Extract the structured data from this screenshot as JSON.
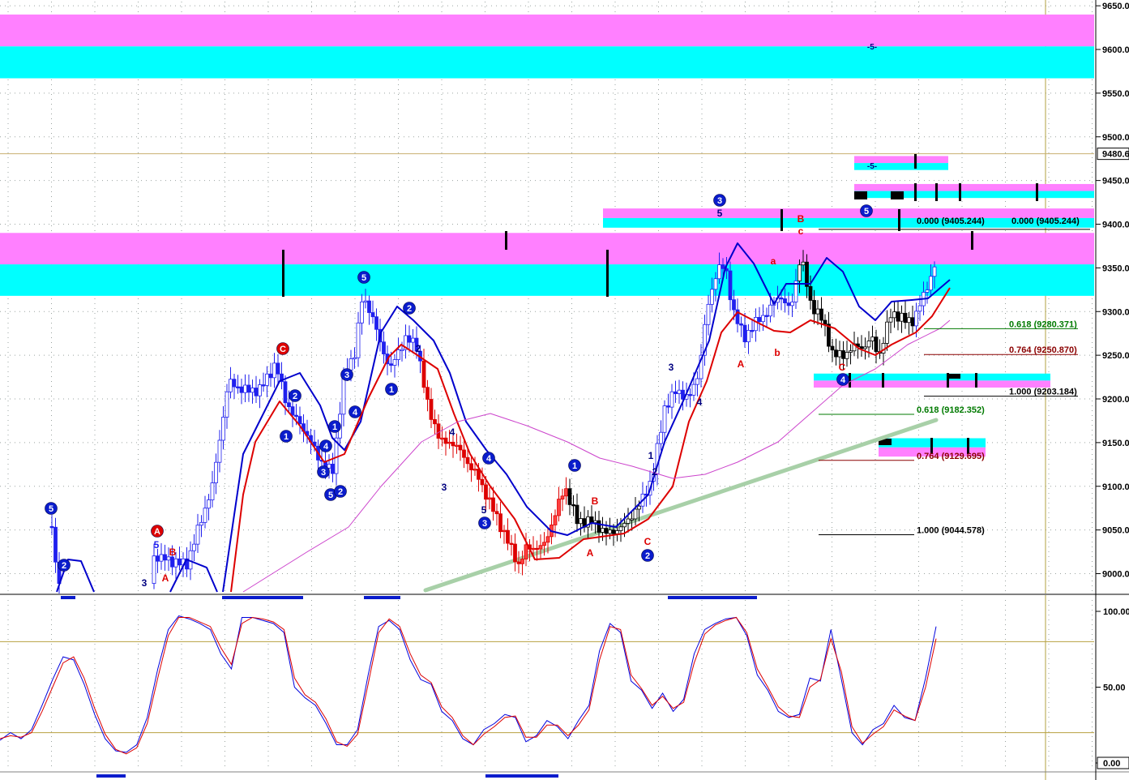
{
  "chart_data": [
    {
      "type": "candlestick",
      "title": "",
      "xlabel": "",
      "ylabel": "",
      "ylim": [
        8980,
        9650
      ],
      "y_ticks": [
        "9650.0",
        "9600.0",
        "9550.0",
        "9500.0",
        "9450.0",
        "9400.0",
        "9350.0",
        "9300.0",
        "9250.0",
        "9200.0",
        "9150.0",
        "9100.0",
        "9050.0",
        "9000.0"
      ],
      "current_price_label": "9480.6",
      "grid": true,
      "bands": [
        {
          "from": 9567,
          "to": 9640,
          "upper_color": "#ff80ff",
          "lower_color": "#00ffff",
          "span": "full"
        },
        {
          "from": 9318,
          "to": 9390,
          "upper_color": "#ff80ff",
          "lower_color": "#00ffff",
          "span": "full"
        },
        {
          "from": 9396,
          "to": 9418,
          "upper_color": "#ff80ff",
          "lower_color": "#00ffff",
          "span": "right"
        },
        {
          "from": 9462,
          "to": 9478,
          "upper_color": "#ff80ff",
          "lower_color": "#00ffff",
          "span": "box"
        },
        {
          "from": 9430,
          "to": 9446,
          "upper_color": "#ff80ff",
          "lower_color": "#00ffff",
          "span": "wide-box"
        },
        {
          "from": 9213,
          "to": 9229,
          "upper_color": "#00ffff",
          "lower_color": "#ff80ff",
          "span": "wide-box"
        },
        {
          "from": 9134,
          "to": 9155,
          "upper_color": "#00ffff",
          "lower_color": "#ff80ff",
          "span": "box"
        }
      ],
      "fib_levels": [
        {
          "label": "0.000 (9405.244)",
          "value": 9405.244,
          "color": "#000000"
        },
        {
          "label": "0.000 (9405.244)",
          "value": 9405.244,
          "color": "#000000"
        },
        {
          "label": "0.618 (9280.371)",
          "value": 9280.371,
          "color": "#007a00"
        },
        {
          "label": "0.764 (9250.870)",
          "value": 9250.87,
          "color": "#8b0000"
        },
        {
          "label": "1.000 (9203.184)",
          "value": 9203.184,
          "color": "#000000"
        },
        {
          "label": "0.618 (9182.352)",
          "value": 9182.352,
          "color": "#007a00"
        },
        {
          "label": "0.764 (9129.695)",
          "value": 9129.695,
          "color": "#8b0000"
        },
        {
          "label": "1.000 (9044.578)",
          "value": 9044.578,
          "color": "#000000"
        }
      ],
      "wave_labels": [
        {
          "text": "5",
          "style": "circle-blue"
        },
        {
          "text": "2",
          "style": "circle-blue"
        },
        {
          "text": "A",
          "style": "circle-red"
        },
        {
          "text": "5",
          "style": "plain-blue"
        },
        {
          "text": "B",
          "style": "plain-red"
        },
        {
          "text": "A",
          "style": "plain-red"
        },
        {
          "text": "3",
          "style": "plain-navy"
        },
        {
          "text": "C",
          "style": "circle-red"
        },
        {
          "text": "2",
          "style": "circle-blue"
        },
        {
          "text": "1",
          "style": "circle-blue"
        },
        {
          "text": "4",
          "style": "circle-blue"
        },
        {
          "text": "1",
          "style": "circle-blue"
        },
        {
          "text": "3",
          "style": "circle-blue"
        },
        {
          "text": "5",
          "style": "circle-blue"
        },
        {
          "text": "2",
          "style": "circle-blue"
        },
        {
          "text": "5",
          "style": "circle-blue"
        },
        {
          "text": "3",
          "style": "circle-blue"
        },
        {
          "text": "4",
          "style": "circle-blue"
        },
        {
          "text": "1",
          "style": "circle-blue"
        },
        {
          "text": "2",
          "style": "circle-blue"
        },
        {
          "text": "2",
          "style": "plain-navy"
        },
        {
          "text": "4",
          "style": "plain-navy"
        },
        {
          "text": "3",
          "style": "plain-navy"
        },
        {
          "text": "4",
          "style": "circle-blue"
        },
        {
          "text": "5",
          "style": "plain-navy"
        },
        {
          "text": "3",
          "style": "circle-blue"
        },
        {
          "text": "1",
          "style": "circle-blue"
        },
        {
          "text": "B",
          "style": "plain-red"
        },
        {
          "text": "A",
          "style": "plain-red"
        },
        {
          "text": "C",
          "style": "plain-red"
        },
        {
          "text": "2",
          "style": "circle-blue"
        },
        {
          "text": "1",
          "style": "plain-navy"
        },
        {
          "text": "2",
          "style": "plain-navy"
        },
        {
          "text": "3",
          "style": "plain-navy"
        },
        {
          "text": "4",
          "style": "plain-navy"
        },
        {
          "text": "3",
          "style": "circle-blue"
        },
        {
          "text": "5",
          "style": "plain-navy"
        },
        {
          "text": "A",
          "style": "plain-red"
        },
        {
          "text": "a",
          "style": "plain-red"
        },
        {
          "text": "b",
          "style": "plain-red"
        },
        {
          "text": "B",
          "style": "plain-red"
        },
        {
          "text": "c",
          "style": "plain-red"
        },
        {
          "text": "5",
          "style": "circle-blue"
        },
        {
          "text": "C",
          "style": "plain-red"
        },
        {
          "text": "4",
          "style": "circle-blue"
        },
        {
          "text": "-5-",
          "style": "plain-navy"
        },
        {
          "text": "-5-",
          "style": "plain-navy"
        }
      ]
    },
    {
      "type": "line",
      "title": "",
      "xlabel": "",
      "ylabel": "",
      "ylim": [
        0,
        100
      ],
      "y_ticks": [
        "100.00",
        "50.00",
        "0.00"
      ],
      "overbought": 80,
      "oversold": 20,
      "series": [
        {
          "color": "#0000dd",
          "values": [
            15,
            20,
            16,
            22,
            38,
            55,
            70,
            68,
            52,
            32,
            16,
            8,
            7,
            12,
            30,
            62,
            88,
            97,
            95,
            92,
            88,
            72,
            62,
            96,
            96,
            94,
            92,
            86,
            50,
            43,
            38,
            26,
            12,
            12,
            22,
            58,
            90,
            94,
            88,
            68,
            55,
            52,
            34,
            28,
            16,
            12,
            22,
            26,
            32,
            30,
            14,
            18,
            28,
            24,
            16,
            28,
            38,
            74,
            92,
            86,
            54,
            48,
            36,
            46,
            34,
            42,
            72,
            88,
            92,
            95,
            96,
            84,
            58,
            48,
            34,
            30,
            32,
            56,
            54,
            88,
            55,
            20,
            12,
            22,
            26,
            38,
            30,
            28,
            56,
            90
          ]
        },
        {
          "color": "#dd0000",
          "values": [
            16,
            18,
            17,
            20,
            34,
            50,
            66,
            70,
            56,
            36,
            19,
            9,
            6,
            10,
            26,
            56,
            84,
            96,
            96,
            93,
            90,
            76,
            65,
            92,
            96,
            95,
            93,
            88,
            56,
            45,
            40,
            29,
            14,
            11,
            19,
            52,
            86,
            95,
            90,
            72,
            58,
            53,
            37,
            30,
            18,
            12,
            19,
            24,
            30,
            31,
            17,
            17,
            25,
            25,
            18,
            25,
            35,
            68,
            90,
            88,
            58,
            49,
            38,
            44,
            36,
            40,
            66,
            85,
            91,
            94,
            96,
            86,
            62,
            50,
            37,
            31,
            30,
            50,
            55,
            82,
            60,
            24,
            13,
            19,
            24,
            35,
            31,
            28,
            50,
            82
          ]
        }
      ]
    }
  ]
}
